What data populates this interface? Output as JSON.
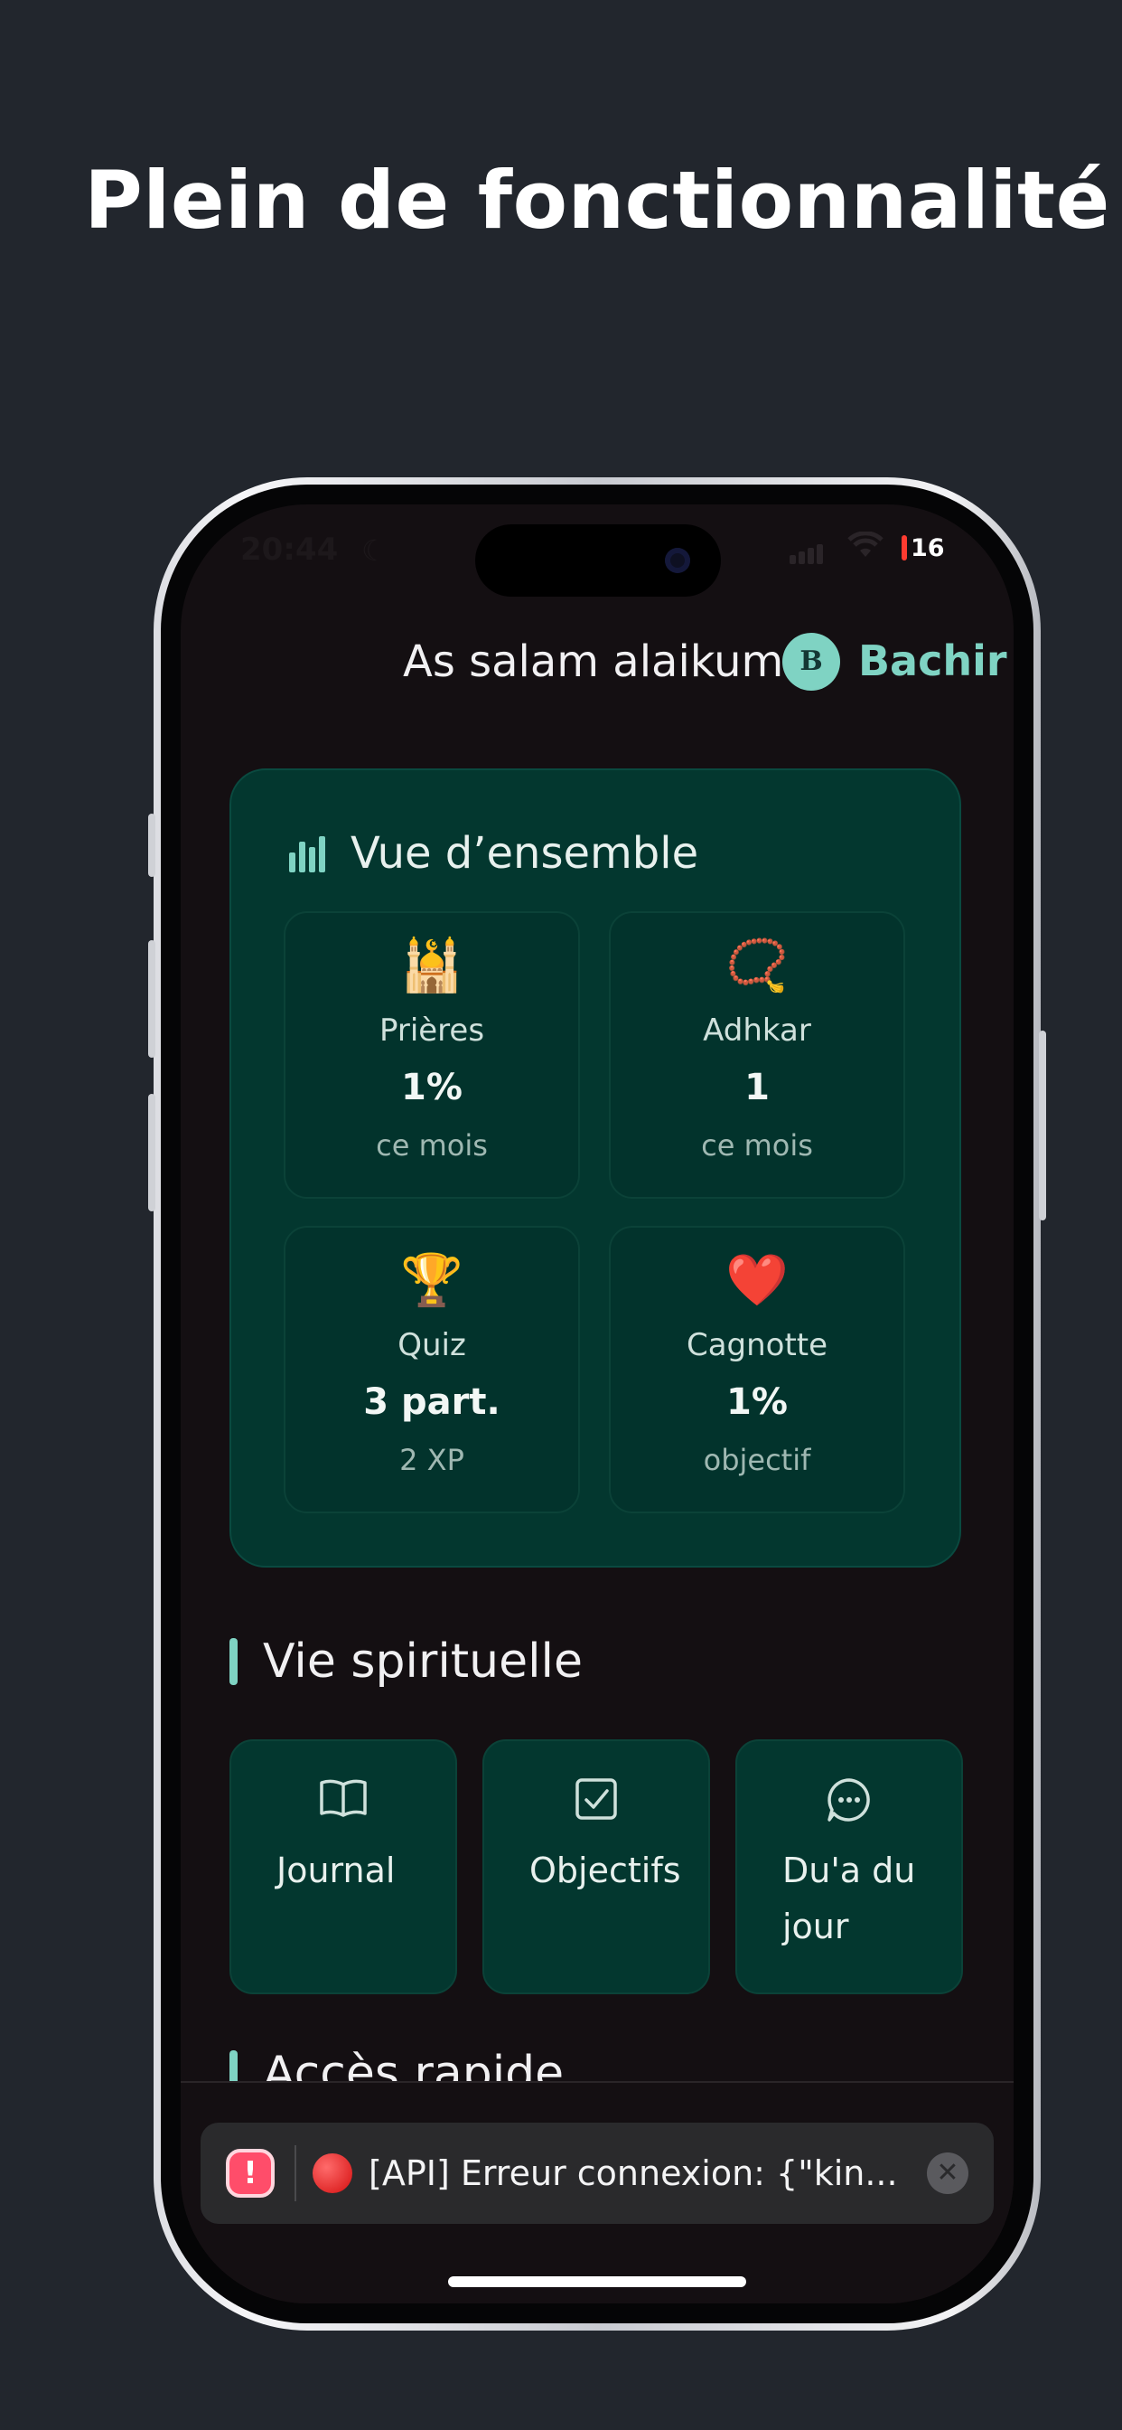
{
  "headline": "Plein de fonctionnalité",
  "status_bar": {
    "time": "20:44",
    "battery": "16"
  },
  "header": {
    "greeting": "As salam alaikum",
    "avatar_initial": "B",
    "user_name": "Bachir"
  },
  "overview": {
    "title": "Vue d’ensemble",
    "stats": [
      {
        "emoji": "🕌",
        "label": "Prières",
        "value": "1%",
        "sub": "ce mois"
      },
      {
        "emoji": "📿",
        "label": "Adhkar",
        "value": "1",
        "sub": "ce mois"
      },
      {
        "emoji": "🏆",
        "label": "Quiz",
        "value": "3 part.",
        "sub": "2 XP"
      },
      {
        "emoji": "❤️",
        "label": "Cagnotte",
        "value": "1%",
        "sub": "objectif"
      }
    ]
  },
  "spiritual": {
    "title": "Vie spirituelle",
    "tiles": [
      {
        "icon": "book-open-icon",
        "label": "Journal"
      },
      {
        "icon": "checkbox-icon",
        "label": "Objectifs"
      },
      {
        "icon": "chat-bubble-icon",
        "label": "Du'a du jour"
      }
    ]
  },
  "quick_access": {
    "title": "Accès rapide"
  },
  "toast": {
    "message": "[API] Erreur connexion: {\"kin..."
  },
  "colors": {
    "accent": "#7fd3c3",
    "card": "#03372f",
    "background": "#140f12",
    "page_bg": "#22262d"
  }
}
